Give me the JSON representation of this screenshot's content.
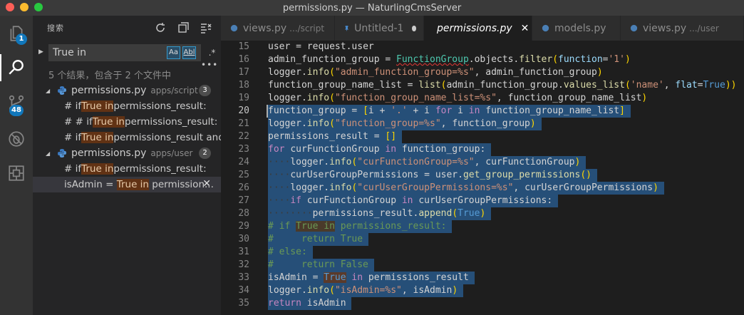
{
  "window": {
    "title": "permissions.py — NaturlingCmsServer"
  },
  "activity": {
    "explorer_badge": "1",
    "scm_badge": "48"
  },
  "sidebar": {
    "title": "搜索",
    "search": {
      "value": "True in",
      "opt_case": "Aa",
      "opt_word": "Abl",
      "opt_regex": ".*"
    },
    "more": "•••",
    "summary": "5 个结果，包含于 2 个文件中",
    "files": [
      {
        "name": "permissions.py",
        "path": "apps/script",
        "count": "3",
        "matches": [
          {
            "pre": "# if ",
            "hit": "True in",
            "post": " permissions_result:"
          },
          {
            "pre": "# # if ",
            "hit": "True in",
            "post": " permissions_result:"
          },
          {
            "pre": "# if ",
            "hit": "True in",
            "post": " permissions_result and..."
          }
        ]
      },
      {
        "name": "permissions.py",
        "path": "apps/user",
        "count": "2",
        "matches": [
          {
            "pre": "# if ",
            "hit": "True in",
            "post": " permissions_result:"
          },
          {
            "pre": "isAdmin = ",
            "hit": "True in",
            "post": " permission..."
          }
        ]
      }
    ]
  },
  "tabs": [
    {
      "name": "views.py",
      "path": ".../script"
    },
    {
      "name": "Untitled-1",
      "path": ""
    },
    {
      "name": "permissions.py",
      "path": ""
    },
    {
      "name": "models.py",
      "path": ""
    },
    {
      "name": "views.py",
      "path": ".../user"
    }
  ],
  "editor": {
    "line_numbers": [
      "15",
      "16",
      "17",
      "18",
      "19",
      "20",
      "21",
      "22",
      "23",
      "24",
      "25",
      "26",
      "27",
      "28",
      "29",
      "30",
      "31",
      "32",
      "33",
      "34",
      "35"
    ],
    "lines": [
      "user = request.user",
      "admin_function_group = FunctionGroup.objects.filter(function='1')",
      "logger.info(\"admin_function_group=%s\", admin_function_group)",
      "function_group_name_list = list(admin_function_group.values_list('name', flat=True))",
      "logger.info(\"function_group_name_list=%s\", function_group_name_list)",
      "function_group = [i + '.' + i for i in function_group_name_list]",
      "logger.info(\"function_group=%s\", function_group)",
      "permissions_result = []",
      "for curFunctionGroup in function_group:",
      "    logger.info(\"curFunctionGroup=%s\", curFunctionGroup)",
      "    curUserGroupPermissions = user.get_group_permissions()",
      "    logger.info(\"curUserGroupPermissions=%s\", curUserGroupPermissions)",
      "    if curFunctionGroup in curUserGroupPermissions:",
      "        permissions_result.append(True)",
      "# if True in permissions_result:",
      "#     return True",
      "# else:",
      "#     return False",
      "isAdmin = True in permissions_result",
      "logger.info(\"isAdmin=%s\", isAdmin)",
      "return isAdmin"
    ]
  },
  "colors": {
    "accent": "#1177bb",
    "selection": "#264f78",
    "find_highlight": "#613214"
  }
}
